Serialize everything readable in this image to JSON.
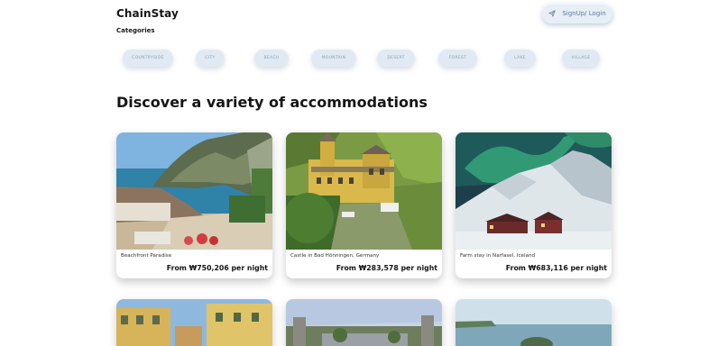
{
  "header": {
    "brand": "ChainStay",
    "login_label": "SignUp/ Login",
    "login_icon": "send-icon"
  },
  "categories": {
    "label": "Categories",
    "items": [
      "COUNTRYSIDE",
      "CITY",
      "BEACH",
      "MOUNTAIN",
      "DESERT",
      "FOREST",
      "LAKE",
      "VILLAGE"
    ]
  },
  "main": {
    "title": "Discover a variety of accommodations",
    "listings": [
      {
        "name": "Beachfront Paradise",
        "price": "From ₩750,206 per night"
      },
      {
        "name": "Castle in Bad Hönningen, Germany",
        "price": "From ₩283,578 per night"
      },
      {
        "name": "Farm stay in Narfasel, Iceland",
        "price": "From ₩683,116 per night"
      }
    ]
  },
  "colors": {
    "chip_bg": "#e1e9f2",
    "chip_text": "#8d9fb4",
    "login_text": "#5b7aa0"
  }
}
